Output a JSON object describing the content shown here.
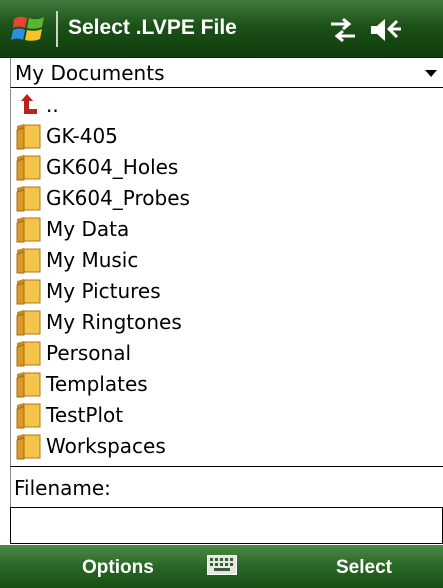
{
  "titlebar": {
    "title": "Select .LVPE File",
    "start_icon": "windows-flag-icon",
    "status_icons": [
      "connectivity-icon",
      "volume-icon"
    ],
    "background": "#1d5219"
  },
  "folder_select": {
    "selected": "My Documents"
  },
  "file_list": {
    "items": [
      {
        "label": "..",
        "icon": "up-arrow-icon"
      },
      {
        "label": "GK-405",
        "icon": "folder-icon"
      },
      {
        "label": "GK604_Holes",
        "icon": "folder-icon"
      },
      {
        "label": "GK604_Probes",
        "icon": "folder-icon"
      },
      {
        "label": "My Data",
        "icon": "folder-icon"
      },
      {
        "label": "My Music",
        "icon": "folder-icon"
      },
      {
        "label": "My Pictures",
        "icon": "folder-icon"
      },
      {
        "label": "My Ringtones",
        "icon": "folder-icon"
      },
      {
        "label": "Personal",
        "icon": "folder-icon"
      },
      {
        "label": "Templates",
        "icon": "folder-icon"
      },
      {
        "label": "TestPlot",
        "icon": "folder-icon"
      },
      {
        "label": "Workspaces",
        "icon": "folder-icon"
      }
    ]
  },
  "filename": {
    "label": "Filename:",
    "value": ""
  },
  "softkeys": {
    "left": "Options",
    "right": "Select",
    "center_icon": "keyboard-icon",
    "background": "#2a6726"
  }
}
